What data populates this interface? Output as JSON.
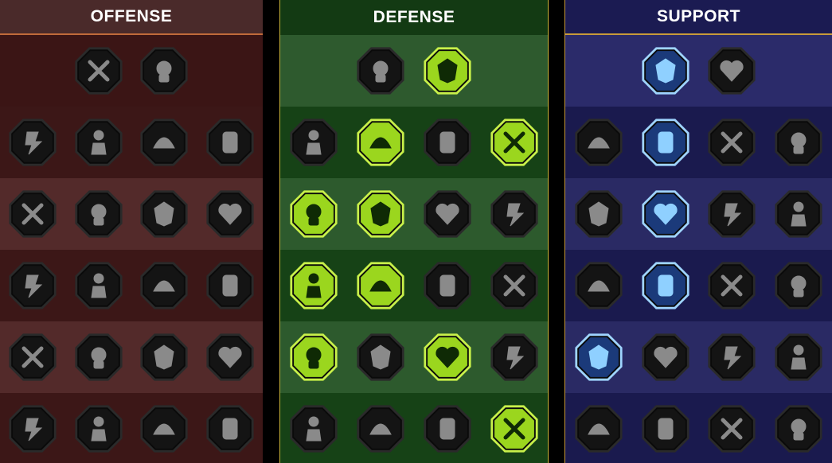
{
  "colors": {
    "offense_bg": "#3c1717",
    "defense_bg": "#164216",
    "support_bg": "#1a1a4e",
    "inactive_icon": "#8a8a8a",
    "defense_active": "#9bd61e",
    "support_active": "#4aa8ff"
  },
  "panels": [
    {
      "key": "offense",
      "title": "OFFENSE",
      "rows": [
        [
          {
            "icon": "crossed-swords-icon",
            "active": false
          },
          {
            "icon": "triple-blades-icon",
            "active": false
          }
        ],
        [
          {
            "icon": "horned-heart-icon",
            "active": false
          },
          {
            "icon": "slashing-blade-icon",
            "active": false
          },
          {
            "icon": "shield-strike-icon",
            "active": false
          },
          {
            "icon": "spiked-heart-icon",
            "active": false
          }
        ],
        [
          {
            "icon": "muscle-fist-icon",
            "active": false
          },
          {
            "icon": "fanged-jaw-icon",
            "active": false
          },
          {
            "icon": "skull-slash-icon",
            "active": false
          },
          {
            "icon": "claw-hand-icon",
            "active": false
          }
        ],
        [
          {
            "icon": "sword-heart-icon",
            "active": false
          },
          {
            "icon": "raised-fist-icon",
            "active": false
          },
          {
            "icon": "axe-icon",
            "active": false
          },
          {
            "icon": "lightning-chains-icon",
            "active": false
          }
        ],
        [
          {
            "icon": "arrows-impact-icon",
            "active": false
          },
          {
            "icon": "triple-skull-icon",
            "active": false
          },
          {
            "icon": "circled-dagger-icon",
            "active": false
          },
          {
            "icon": "raging-figure-icon",
            "active": false
          }
        ],
        [
          {
            "icon": "sparkle-sword-icon",
            "active": false
          },
          {
            "icon": "flaming-helmet-icon",
            "active": false
          },
          {
            "icon": "demon-figure-icon",
            "active": false
          },
          {
            "icon": "spiked-skull-icon",
            "active": false
          }
        ]
      ]
    },
    {
      "key": "defense",
      "title": "DEFENSE",
      "rows": [
        [
          {
            "icon": "armor-plates-icon",
            "active": false
          },
          {
            "icon": "raised-fist-icon",
            "active": true
          }
        ],
        [
          {
            "icon": "chevron-shield-icon",
            "active": false
          },
          {
            "icon": "anatomical-heart-icon",
            "active": true
          },
          {
            "icon": "armored-torso-icon",
            "active": false
          },
          {
            "icon": "crossed-blades-icon",
            "active": true
          }
        ],
        [
          {
            "icon": "dodge-figure-icon",
            "active": true
          },
          {
            "icon": "sword-and-shield-icon",
            "active": true
          },
          {
            "icon": "skull-heart-icon",
            "active": false
          },
          {
            "icon": "hooded-head-icon",
            "active": false
          }
        ],
        [
          {
            "icon": "rallying-crowd-icon",
            "active": true
          },
          {
            "icon": "hourglass-icon",
            "active": true
          },
          {
            "icon": "open-palm-icon",
            "active": false
          },
          {
            "icon": "bull-head-icon",
            "active": false
          }
        ],
        [
          {
            "icon": "dashing-figure-icon",
            "active": true
          },
          {
            "icon": "triple-drops-icon",
            "active": false
          },
          {
            "icon": "radiant-skull-icon",
            "active": true
          },
          {
            "icon": "swirl-hand-icon",
            "active": false
          }
        ],
        [
          {
            "icon": "spiked-beast-icon",
            "active": false
          },
          {
            "icon": "winged-shield-icon",
            "active": false
          },
          {
            "icon": "cracked-skull-icon",
            "active": false
          },
          {
            "icon": "flexing-figure-icon",
            "active": true
          }
        ]
      ]
    },
    {
      "key": "support",
      "title": "SUPPORT",
      "rows": [
        [
          {
            "icon": "sparkling-heart-icon",
            "active": true
          },
          {
            "icon": "swirling-shards-icon",
            "active": false
          }
        ],
        [
          {
            "icon": "praying-hands-icon",
            "active": false
          },
          {
            "icon": "shielded-aura-icon",
            "active": true
          },
          {
            "icon": "smoke-skull-icon",
            "active": false
          },
          {
            "icon": "speed-boot-icon",
            "active": false
          }
        ],
        [
          {
            "icon": "blessed-figure-icon",
            "active": false
          },
          {
            "icon": "charged-bolt-icon",
            "active": true
          },
          {
            "icon": "shattered-ground-icon",
            "active": false
          },
          {
            "icon": "shadow-figures-icon",
            "active": false
          }
        ],
        [
          {
            "icon": "chained-heart-icon",
            "active": false
          },
          {
            "icon": "meteor-icon",
            "active": true
          },
          {
            "icon": "open-book-icon",
            "active": false
          },
          {
            "icon": "glaring-eyes-icon",
            "active": false
          }
        ],
        [
          {
            "icon": "compass-star-icon",
            "active": true
          },
          {
            "icon": "winged-boot-icon",
            "active": false
          },
          {
            "icon": "all-seeing-eye-icon",
            "active": false
          },
          {
            "icon": "scarecrow-icon",
            "active": false
          }
        ],
        [
          {
            "icon": "poison-flask-icon",
            "active": false
          },
          {
            "icon": "grim-skull-icon",
            "active": false
          },
          {
            "icon": "clenched-fist-icon",
            "active": false
          },
          {
            "icon": "eagle-head-icon",
            "active": false
          }
        ]
      ]
    }
  ]
}
